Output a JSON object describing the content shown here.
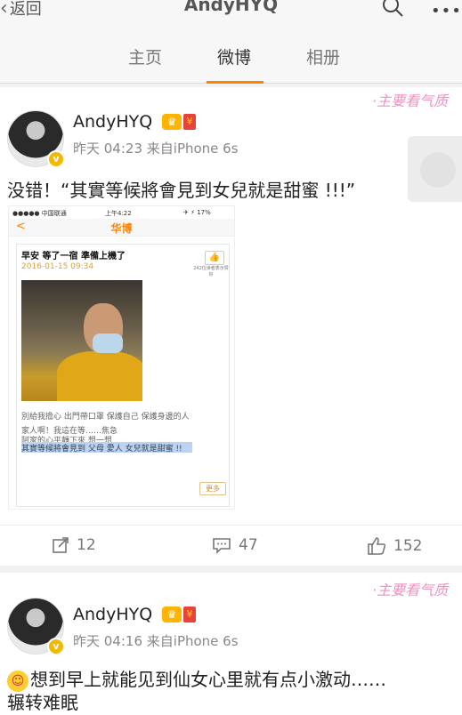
{
  "nav": {
    "back_label": "返回",
    "title": "AndyHYQ",
    "search_icon": "search-icon",
    "more_label": "•••"
  },
  "tabs": [
    {
      "label": "主页"
    },
    {
      "label": "微博",
      "active": true
    },
    {
      "label": "相册"
    }
  ],
  "colors": {
    "accent": "#ff8200",
    "background": "#f2f2f2",
    "watermark": "#f08fc0"
  },
  "watermark_text": "·主要看气质",
  "posts": [
    {
      "username": "AndyHYQ",
      "time": "昨天 04:23",
      "source": "来自iPhone 6s",
      "text": "没错！“其實等候將會見到女兒就是甜蜜 !!!”",
      "embedded": {
        "status_carrier": "●●●●● 中国联通 ",
        "status_time": "上午4:22",
        "status_battery": "✈ ⚡ 17% ",
        "nav_back": "<",
        "nav_title": "华博",
        "card_title": "早安 等了一宿 準備上機了",
        "card_date": "2016-01-15 09:34",
        "thumb": "👍",
        "like_text": "242位读者表示赞好",
        "line1": "別給我擔心 出門帶口罩 保護自己 保護身邊的人",
        "line2": "家人啊！我這在等……焦急",
        "line3": "阿家的心平靜下來 想一想",
        "line4": "其實等候將會見到 父母 愛人 女兒就是甜蜜 !!",
        "more_button": "更多"
      },
      "reposts": "12",
      "comments": "47",
      "likes": "152"
    },
    {
      "username": "AndyHYQ",
      "time": "昨天 04:16",
      "source": "来自iPhone 6s",
      "text_line1": "想到早上就能见到仙女心里就有点小激动……",
      "text_line2": "辗转难眠"
    }
  ]
}
